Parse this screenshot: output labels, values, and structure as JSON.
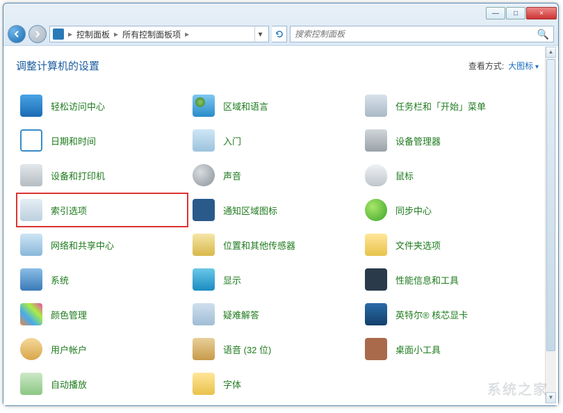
{
  "window": {
    "min": "—",
    "max": "□",
    "close": "×"
  },
  "breadcrumb": {
    "root": "控制面板",
    "current": "所有控制面板项",
    "separator": "▸"
  },
  "search": {
    "placeholder": "搜索控制面板"
  },
  "heading": "调整计算机的设置",
  "view": {
    "label": "查看方式:",
    "value": "大图标"
  },
  "items": [
    {
      "label": "轻松访问中心",
      "icon": "ic-ease"
    },
    {
      "label": "区域和语言",
      "icon": "ic-region"
    },
    {
      "label": "任务栏和「开始」菜单",
      "icon": "ic-taskbar"
    },
    {
      "label": "日期和时间",
      "icon": "ic-date"
    },
    {
      "label": "入门",
      "icon": "ic-start"
    },
    {
      "label": "设备管理器",
      "icon": "ic-devmgr"
    },
    {
      "label": "设备和打印机",
      "icon": "ic-printer"
    },
    {
      "label": "声音",
      "icon": "ic-sound"
    },
    {
      "label": "鼠标",
      "icon": "ic-mouse"
    },
    {
      "label": "索引选项",
      "icon": "ic-index",
      "highlight": true
    },
    {
      "label": "通知区域图标",
      "icon": "ic-notify"
    },
    {
      "label": "同步中心",
      "icon": "ic-sync"
    },
    {
      "label": "网络和共享中心",
      "icon": "ic-network"
    },
    {
      "label": "位置和其他传感器",
      "icon": "ic-location"
    },
    {
      "label": "文件夹选项",
      "icon": "ic-folder"
    },
    {
      "label": "系统",
      "icon": "ic-system"
    },
    {
      "label": "显示",
      "icon": "ic-display"
    },
    {
      "label": "性能信息和工具",
      "icon": "ic-perf"
    },
    {
      "label": "颜色管理",
      "icon": "ic-color"
    },
    {
      "label": "疑难解答",
      "icon": "ic-trouble"
    },
    {
      "label": "英特尔® 核芯显卡",
      "icon": "ic-intel"
    },
    {
      "label": "用户帐户",
      "icon": "ic-user"
    },
    {
      "label": "语音 (32 位)",
      "icon": "ic-speech"
    },
    {
      "label": "桌面小工具",
      "icon": "ic-gadget"
    },
    {
      "label": "自动播放",
      "icon": "ic-autoplay"
    },
    {
      "label": "字体",
      "icon": "ic-font"
    }
  ],
  "watermark": "系统之家"
}
